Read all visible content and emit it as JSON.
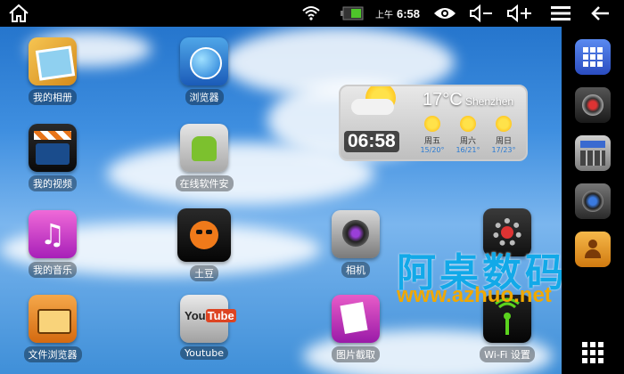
{
  "status_bar": {
    "home_icon": "home-icon",
    "wifi_icon": "wifi-icon",
    "battery_icon": "battery-icon",
    "ampm": "上午",
    "time": "6:58",
    "eye_icon": "eye-icon",
    "vol_down_icon": "volume-down-icon",
    "vol_up_icon": "volume-up-icon",
    "menu_icon": "menu-icon",
    "back_icon": "back-icon"
  },
  "apps": [
    {
      "label": "我的相册",
      "icon": "photo-album-icon"
    },
    {
      "label": "浏览器",
      "icon": "browser-globe-icon"
    },
    {
      "label": "我的视频",
      "icon": "video-clapper-icon"
    },
    {
      "label": "在线软件安",
      "icon": "android-market-icon"
    },
    {
      "label": "我的音乐",
      "icon": "music-note-icon"
    },
    {
      "label": "土豆",
      "icon": "tudou-icon"
    },
    {
      "label": "相机",
      "icon": "camera-icon"
    },
    {
      "label": "文件浏览器",
      "icon": "file-browser-icon"
    },
    {
      "label": "Youtube",
      "icon": "youtube-icon"
    },
    {
      "label": "图片截取",
      "icon": "screenshot-icon"
    },
    {
      "label": "Wi-Fi 设置",
      "icon": "wifi-settings-icon"
    },
    {
      "label": "",
      "icon": "settings-gear-icon"
    }
  ],
  "weather": {
    "temperature": "17°C",
    "city": "Shenzhen",
    "clock": "06:58",
    "days": [
      {
        "name": "周五",
        "range": "15/20°"
      },
      {
        "name": "周六",
        "range": "16/21°"
      },
      {
        "name": "周日",
        "range": "17/23°"
      }
    ]
  },
  "watermark": {
    "title": "阿桌数码",
    "url": "www.azhuo.net"
  },
  "dock": {
    "items": [
      "app-grid-icon",
      "speaker-icon",
      "calculator-icon",
      "camera-lens-icon",
      "contacts-icon",
      "all-apps-icon"
    ]
  },
  "colors": {
    "accent": "#12a9e8",
    "watermark_url": "#f0a800"
  }
}
